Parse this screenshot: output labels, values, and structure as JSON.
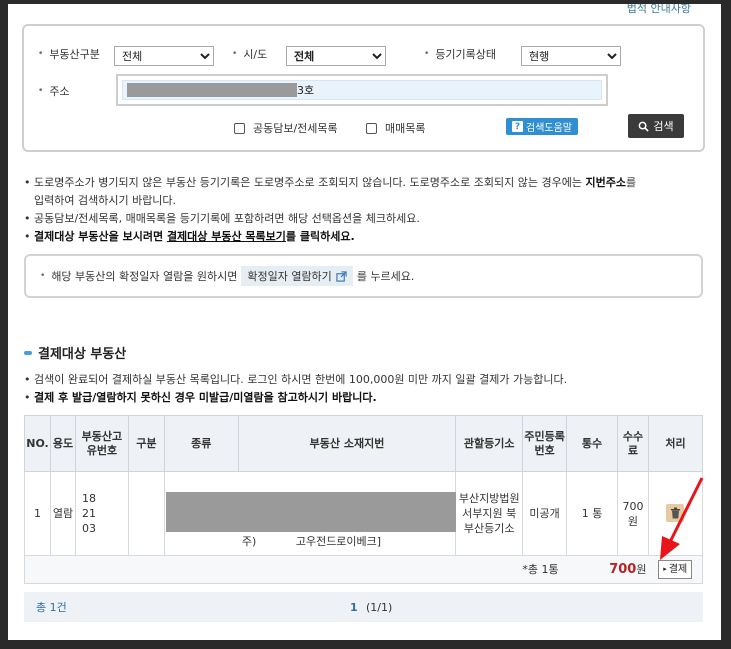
{
  "top_link": "법적 안내사항",
  "filters": {
    "property_type_label": "부동산구분",
    "property_type_value": "전체",
    "region_label": "시/도",
    "region_value": "전체",
    "status_label": "등기기록상태",
    "status_value": "현행",
    "address_label": "주소",
    "address_suffix": "3호",
    "mortgage_label": "공동담보/전세목록",
    "sale_label": "매매목록",
    "help_label": "검색도움말",
    "search_label": "검색"
  },
  "notes": {
    "line1a": "도로명주소가 병기되지 않은 부동산 등기기록은 도로명주소로 조회되지 않습니다. 도로명주소로 조회되지 않는 경우에는 ",
    "line1b": "지번주소",
    "line1c": "를",
    "line1d": "입력하여 검색하시기 바랍니다.",
    "line2": "공동담보/전세목록, 매매목록을 등기기록에 포함하려면 해당 선택옵션을 체크하세요.",
    "line3a": "결제대상 부동산을 보시려면 ",
    "line3b": "결제대상 부동산 목록보기",
    "line3c": "를 클릭하세요."
  },
  "confirm": {
    "text_before": "해당 부동산의 확정일자 열람을 원하시면",
    "button": "확정일자 열람하기",
    "text_after": "를 누르세요."
  },
  "section_title": "결제대상 부동산",
  "section_notes": {
    "line1": "검색이 완료되어 결제하실 부동산 목록입니다. 로그인 하시면 한번에 100,000원 미만 까지 일괄 결제가 가능합니다.",
    "line2": "결제 후 발급/열람하지 못하신 경우 미발급/미열람을 참고하시기 바랍니다."
  },
  "table": {
    "headers": [
      "NO.",
      "용도",
      "부동산고유번호",
      "구분",
      "종류",
      "부동산 소재지번",
      "관할등기소",
      "주민등록번호",
      "통수",
      "수수료",
      "처리"
    ],
    "row": {
      "no": "1",
      "usage": "열람",
      "id_line1": "18",
      "id_line2": "21",
      "id_line3": "03",
      "kind_suffix": "주)",
      "address_tail": "고우전드로이베크]",
      "office": "부산지방법원 서부지원 북부산등기소",
      "resident_no": "미공개",
      "copies": "1 통",
      "fee": "700 원"
    },
    "totals": {
      "count_label": "*총 1통",
      "amount": "700",
      "amount_unit": "원",
      "pay_label": "결제"
    }
  },
  "pager": {
    "total": "총 1건",
    "current": "1",
    "pages": "(1/1)"
  },
  "colors": {
    "accent_blue": "#2f8fd0",
    "amount_red": "#b8232a",
    "arrow_red": "#e8141a"
  }
}
